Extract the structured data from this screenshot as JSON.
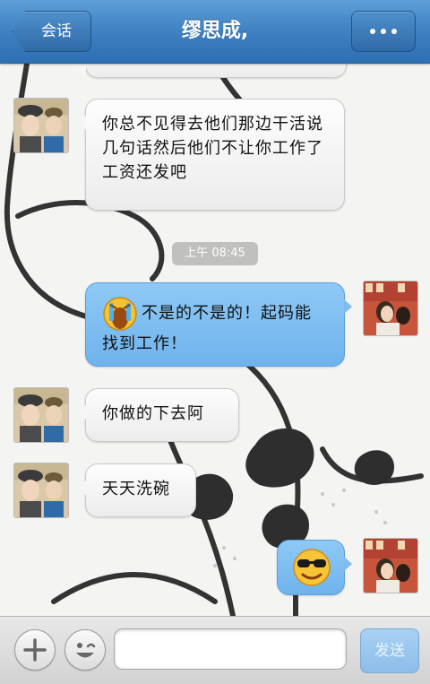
{
  "header": {
    "back_label": "会话",
    "title": "缪思成,"
  },
  "chat": {
    "timestamp": "上午 08:45",
    "messages": [
      {
        "side": "left",
        "text": "你总不见得去他们那边干活说几句话然后他们不让你工作了工资还发吧"
      },
      {
        "side": "right",
        "emoji": "crying-emoji-icon",
        "text": "不是的不是的！起码能找到工作！"
      },
      {
        "side": "left",
        "text": "你做的下去阿"
      },
      {
        "side": "left",
        "text": "天天洗碗"
      },
      {
        "side": "right",
        "emoji": "sunglasses-emoji-icon",
        "text": ""
      }
    ]
  },
  "composer": {
    "input_value": "",
    "send_label": "发送"
  },
  "colors": {
    "header_blue": "#3c7ec0",
    "right_bubble": "#7cbcf0",
    "left_bubble": "#f3f3f3"
  }
}
